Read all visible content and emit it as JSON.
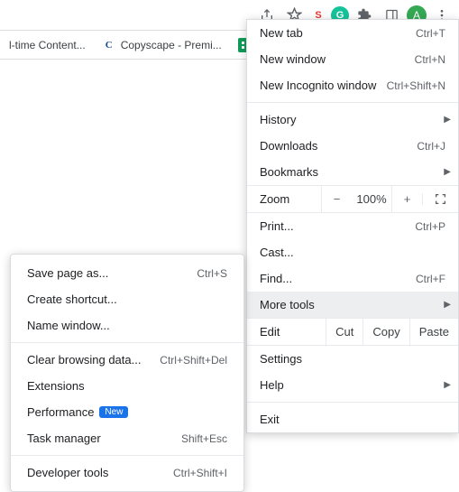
{
  "toolbar": {
    "ext_s": "S",
    "ext_g": "G",
    "avatar_letter": "A"
  },
  "bookmarks": {
    "item0": {
      "label": "l-time Content..."
    },
    "item1": {
      "favicon": "C",
      "label": "Copyscape - Premi..."
    }
  },
  "menu": {
    "new_tab": "New tab",
    "new_tab_sc": "Ctrl+T",
    "new_window": "New window",
    "new_window_sc": "Ctrl+N",
    "incognito": "New Incognito window",
    "incognito_sc": "Ctrl+Shift+N",
    "history": "History",
    "downloads": "Downloads",
    "downloads_sc": "Ctrl+J",
    "bookmarks": "Bookmarks",
    "zoom_label": "Zoom",
    "zoom_minus": "−",
    "zoom_value": "100%",
    "zoom_plus": "+",
    "print": "Print...",
    "print_sc": "Ctrl+P",
    "cast": "Cast...",
    "find": "Find...",
    "find_sc": "Ctrl+F",
    "more_tools": "More tools",
    "edit_label": "Edit",
    "cut": "Cut",
    "copy": "Copy",
    "paste": "Paste",
    "settings": "Settings",
    "help": "Help",
    "exit": "Exit"
  },
  "sub": {
    "save_page": "Save page as...",
    "save_page_sc": "Ctrl+S",
    "create_shortcut": "Create shortcut...",
    "name_window": "Name window...",
    "clear_data": "Clear browsing data...",
    "clear_data_sc": "Ctrl+Shift+Del",
    "extensions": "Extensions",
    "performance": "Performance",
    "new_badge": "New",
    "task_manager": "Task manager",
    "task_manager_sc": "Shift+Esc",
    "dev_tools": "Developer tools",
    "dev_tools_sc": "Ctrl+Shift+I"
  }
}
